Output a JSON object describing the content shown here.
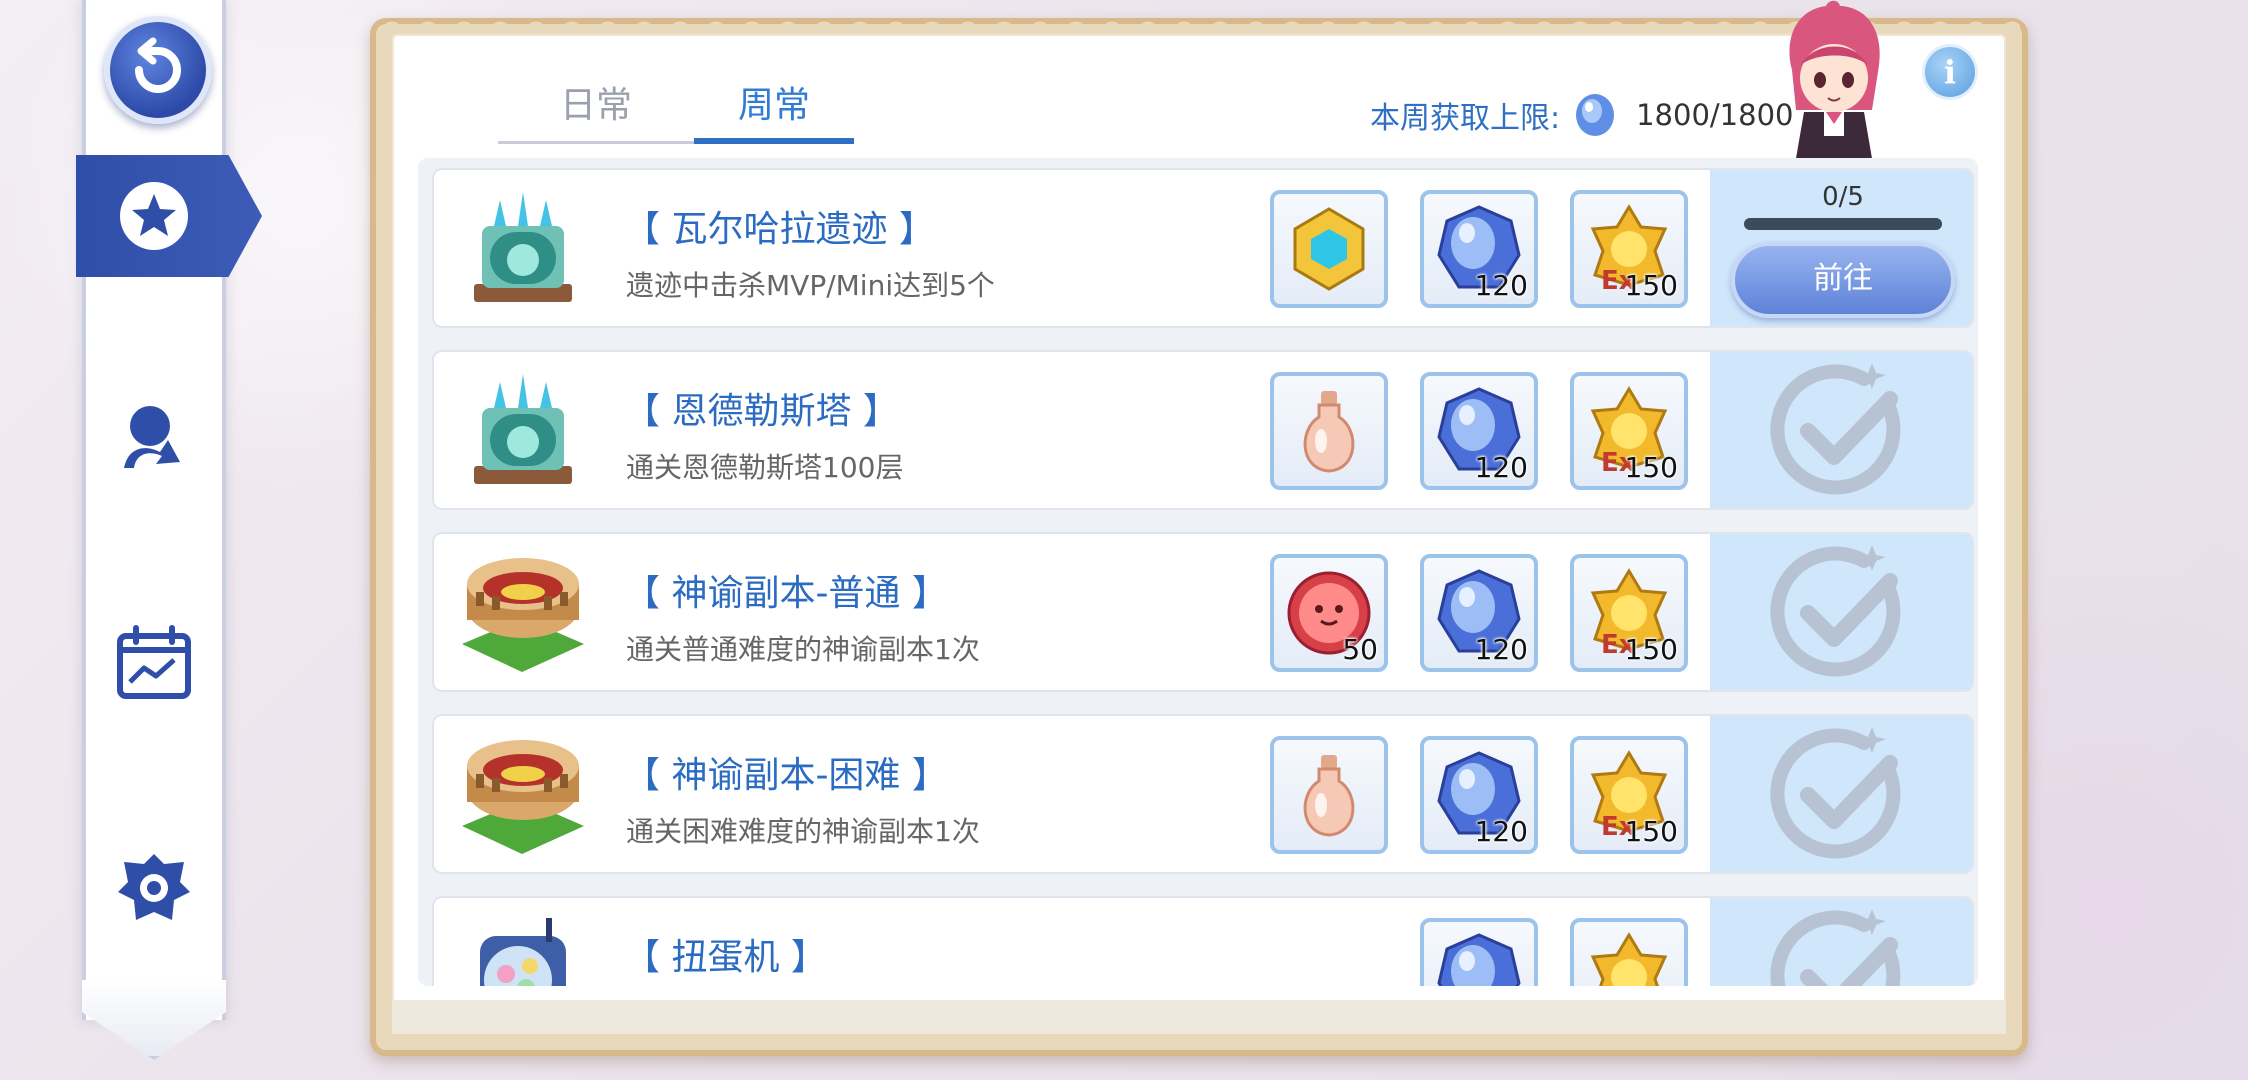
{
  "sidebar": {
    "back_icon": "back-arrow-icon",
    "items": [
      {
        "name": "weekly-tasks",
        "icon": "star-badge-icon",
        "active": true
      },
      {
        "name": "growth",
        "icon": "growth-arrow-icon",
        "active": false
      },
      {
        "name": "calendar",
        "icon": "calendar-chart-icon",
        "active": false
      },
      {
        "name": "guild",
        "icon": "guild-emblem-icon",
        "active": false
      }
    ]
  },
  "tabs": [
    {
      "label": "日常",
      "active": false
    },
    {
      "label": "周常",
      "active": true
    }
  ],
  "weekly_limit": {
    "label": "本周获取上限:",
    "value": "1800/1800",
    "icon": "crystal-icon"
  },
  "info_button": {
    "label": "i"
  },
  "tasks": [
    {
      "title": "【 瓦尔哈拉遗迹 】",
      "description": "遗迹中击杀MVP/Mini达到5个",
      "icon": "ruins-portal-icon",
      "rewards": [
        {
          "icon": "golden-cube-icon",
          "count": ""
        },
        {
          "icon": "blue-crystal-icon",
          "count": "120"
        },
        {
          "icon": "ex-badge-icon",
          "count": "150"
        }
      ],
      "status": "in-progress",
      "progress_text": "0/5",
      "progress_fraction": 0.0,
      "button_label": "前往"
    },
    {
      "title": "【 恩德勒斯塔 】",
      "description": "通关恩德勒斯塔100层",
      "icon": "ruins-portal-icon",
      "rewards": [
        {
          "icon": "potion-bottle-icon",
          "count": ""
        },
        {
          "icon": "blue-crystal-icon",
          "count": "120"
        },
        {
          "icon": "ex-badge-icon",
          "count": "150"
        }
      ],
      "status": "completed"
    },
    {
      "title": "【 神谕副本-普通 】",
      "description": "通关普通难度的神谕副本1次",
      "icon": "colosseum-icon",
      "rewards": [
        {
          "icon": "red-poring-coin-icon",
          "count": "50"
        },
        {
          "icon": "blue-crystal-icon",
          "count": "120"
        },
        {
          "icon": "ex-badge-icon",
          "count": "150"
        }
      ],
      "status": "completed"
    },
    {
      "title": "【 神谕副本-困难 】",
      "description": "通关困难难度的神谕副本1次",
      "icon": "colosseum-icon",
      "rewards": [
        {
          "icon": "potion-bottle-icon",
          "count": ""
        },
        {
          "icon": "blue-crystal-icon",
          "count": "120"
        },
        {
          "icon": "ex-badge-icon",
          "count": "150"
        }
      ],
      "status": "completed"
    },
    {
      "title": "【 扭蛋机 】",
      "description": "",
      "icon": "gacha-machine-icon",
      "rewards": [
        {
          "icon": "blue-crystal-icon",
          "count": ""
        },
        {
          "icon": "ex-badge-icon",
          "count": ""
        }
      ],
      "status": "completed"
    }
  ]
}
